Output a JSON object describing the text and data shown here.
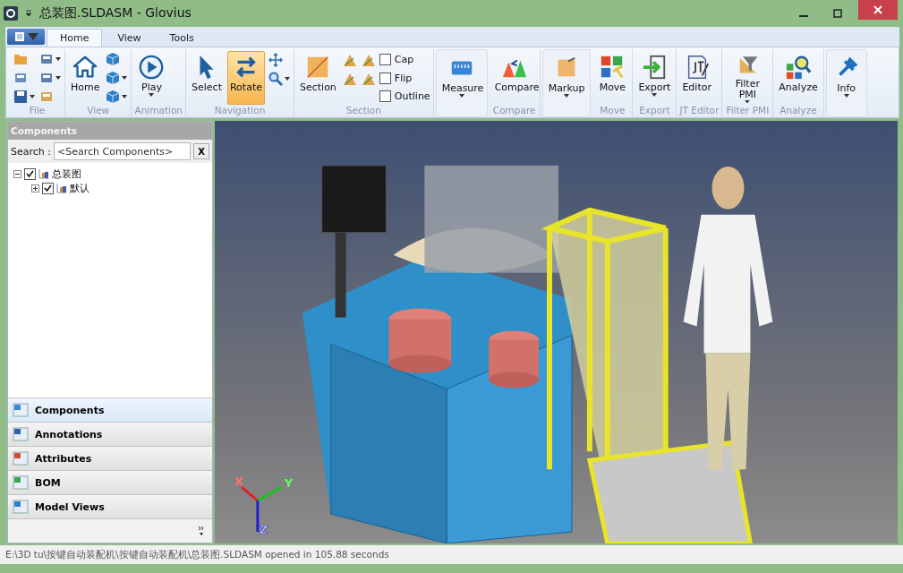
{
  "window": {
    "title": "总装图.SLDASM - Glovius"
  },
  "ribbon": {
    "tabs": [
      {
        "label": "Home",
        "selected": true
      },
      {
        "label": "View",
        "selected": false
      },
      {
        "label": "Tools",
        "selected": false
      }
    ],
    "groups": [
      {
        "label": "File",
        "columns": [
          [
            {
              "kind": "icon",
              "dropdown": false
            },
            {
              "kind": "icon",
              "dropdown": false
            },
            {
              "kind": "icon",
              "dropdown": true
            }
          ],
          [
            {
              "kind": "icon",
              "dropdown": true
            },
            {
              "kind": "icon",
              "dropdown": true
            },
            {
              "kind": "icon",
              "dropdown": false
            }
          ]
        ]
      },
      {
        "label": "View",
        "columns": [
          [
            {
              "kind": "large",
              "label": "Home",
              "dropdown": false,
              "selected": false
            }
          ],
          [
            {
              "kind": "icon",
              "dropdown": false
            },
            {
              "kind": "icon",
              "dropdown": true
            },
            {
              "kind": "icon",
              "dropdown": true
            }
          ]
        ]
      },
      {
        "label": "Animation",
        "columns": [
          [
            {
              "kind": "large",
              "label": "Play",
              "dropdown": true,
              "selected": false
            }
          ]
        ]
      },
      {
        "label": "Navigation",
        "columns": [
          [
            {
              "kind": "large",
              "label": "Select",
              "dropdown": false,
              "selected": false
            }
          ],
          [
            {
              "kind": "large",
              "label": "Rotate",
              "dropdown": false,
              "selected": true
            }
          ],
          [
            {
              "kind": "icon",
              "dropdown": false
            },
            {
              "kind": "icon",
              "dropdown": true
            }
          ]
        ]
      },
      {
        "label": "Section",
        "columns": [
          [
            {
              "kind": "large",
              "label": "Section",
              "dropdown": false,
              "selected": false
            }
          ],
          [
            {
              "kind": "icon",
              "dropdown": false
            },
            {
              "kind": "icon",
              "dropdown": false
            }
          ],
          [
            {
              "kind": "icon",
              "dropdown": false
            },
            {
              "kind": "icon",
              "dropdown": false
            }
          ],
          [
            {
              "kind": "check",
              "label": "Cap",
              "checked": false
            },
            {
              "kind": "check",
              "label": "Flip",
              "checked": false
            },
            {
              "kind": "check",
              "label": "Outline",
              "checked": false
            }
          ]
        ]
      },
      {
        "columns": [
          [
            {
              "kind": "large",
              "label": "Measure",
              "dropdown": true,
              "selected": false
            }
          ]
        ]
      },
      {
        "label": "Compare",
        "columns": [
          [
            {
              "kind": "large",
              "label": "Compare",
              "dropdown": false,
              "selected": false
            }
          ]
        ]
      },
      {
        "columns": [
          [
            {
              "kind": "large",
              "label": "Markup",
              "dropdown": true,
              "selected": false
            }
          ]
        ]
      },
      {
        "label": "Move",
        "columns": [
          [
            {
              "kind": "large",
              "label": "Move",
              "dropdown": false,
              "selected": false
            }
          ]
        ]
      },
      {
        "label": "Export",
        "columns": [
          [
            {
              "kind": "large",
              "label": "Export",
              "dropdown": true,
              "selected": false
            }
          ]
        ]
      },
      {
        "label": "JT Editor",
        "columns": [
          [
            {
              "kind": "large",
              "label": "Editor",
              "dropdown": false,
              "selected": false
            }
          ]
        ]
      },
      {
        "label": "Filter PMI",
        "columns": [
          [
            {
              "kind": "large",
              "label": "Filter PMI",
              "dropdown": true,
              "selected": false
            }
          ]
        ]
      },
      {
        "label": "Analyze",
        "columns": [
          [
            {
              "kind": "large",
              "label": "Analyze",
              "dropdown": false,
              "selected": false
            }
          ]
        ]
      },
      {
        "columns": [
          [
            {
              "kind": "large",
              "label": "Info",
              "dropdown": true,
              "selected": false
            }
          ]
        ]
      }
    ]
  },
  "panel": {
    "title": "Components",
    "search": {
      "label": "Search :",
      "placeholder": "<Search Components>",
      "clear": "X"
    },
    "tree": [
      {
        "label": "总装图",
        "checked": true,
        "expanded": true,
        "children": [
          {
            "label": "默认",
            "checked": true,
            "expanded": false
          }
        ]
      }
    ],
    "nav": [
      {
        "label": "Components",
        "selected": true
      },
      {
        "label": "Annotations",
        "selected": false
      },
      {
        "label": "Attributes",
        "selected": false
      },
      {
        "label": "BOM",
        "selected": false
      },
      {
        "label": "Model Views",
        "selected": false
      }
    ]
  },
  "viewport": {
    "axes": [
      "X",
      "Y",
      "Z"
    ]
  },
  "status_bar": "E:\\3D tu\\按键自动装配机\\按键自动装配机\\总装图.SLDASM opened in 105.88 seconds"
}
